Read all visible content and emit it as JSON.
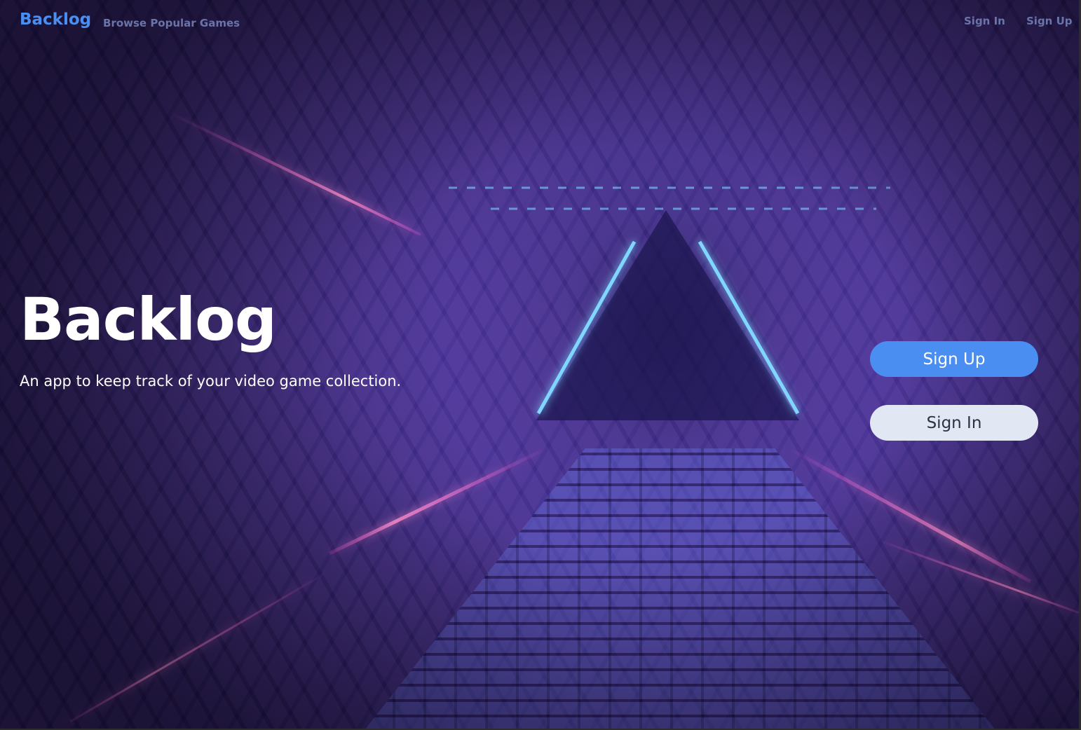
{
  "nav": {
    "logo": "Backlog",
    "browse_label": "Browse Popular Games",
    "signin_label": "Sign In",
    "signup_label": "Sign Up"
  },
  "hero": {
    "title": "Backlog",
    "subtitle": "An app to keep track of your video game collection.",
    "signup_button": "Sign Up",
    "signin_button": "Sign In"
  },
  "colors": {
    "accent": "#4a8ef2",
    "nav_link": "#6a74a8",
    "secondary_button": "#e1e8f4",
    "neon_blue": "#7fd6ff",
    "neon_pink": "#ff5fd8"
  }
}
